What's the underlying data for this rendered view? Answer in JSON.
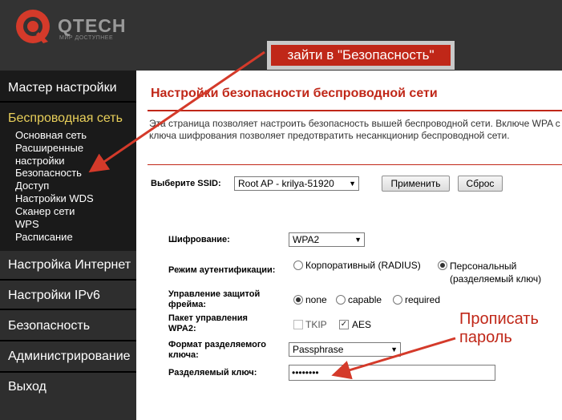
{
  "brand": {
    "name": "QTECH",
    "tagline": "МИР ДОСТУПНЕЕ",
    "accent_color": "#c02718",
    "logo_icon": "qtech-logo-icon"
  },
  "sidebar": {
    "items": [
      {
        "label": "Мастер настройки"
      },
      {
        "label": "Беспроводная сеть",
        "active": true,
        "children": [
          {
            "label": "Основная сеть"
          },
          {
            "label": "Расширенные настройки"
          },
          {
            "label": "Безопасность"
          },
          {
            "label": "Доступ"
          },
          {
            "label": "Настройки WDS"
          },
          {
            "label": "Сканер сети"
          },
          {
            "label": "WPS"
          },
          {
            "label": "Расписание"
          }
        ]
      },
      {
        "label": "Настройка Интернет"
      },
      {
        "label": "Настройки IPv6"
      },
      {
        "label": "Безопасность"
      },
      {
        "label": "Администрирование"
      },
      {
        "label": "Выход"
      }
    ]
  },
  "main": {
    "title": "Настройки безопасности беспроводной сети",
    "description": "Эта страница позволяет настроить безопасность вышей беспроводной сети. Включе WPA с использованием ключа шифрования позволяет предотвратить несанкционир беспроводной сети.",
    "ssid": {
      "label": "Выберите SSID:",
      "value": "Root AP - krilya-51920",
      "apply_label": "Применить",
      "reset_label": "Сброс"
    },
    "encryption": {
      "label": "Шифрование:",
      "value": "WPA2"
    },
    "auth_mode": {
      "label": "Режим аутентификации:",
      "options": [
        "Корпоративный (RADIUS)",
        "Персональный (разделяемый ключ)"
      ],
      "selected": "Персональный (разделяемый ключ)"
    },
    "frame_protection": {
      "label": "Управление защитой фрейма:",
      "options": [
        "none",
        "capable",
        "required"
      ],
      "selected": "none"
    },
    "wpa2_cipher": {
      "label": "Пакет управления WPA2:",
      "tkip_label": "TKIP",
      "aes_label": "AES",
      "aes_checked": true,
      "tkip_checked": false
    },
    "psk_format": {
      "label": "Формат разделяемого ключа:",
      "value": "Passphrase"
    },
    "psk": {
      "label": "Разделяемый ключ:",
      "masked_value": "••••••••"
    }
  },
  "annotations": {
    "callout": "зайти в \"Безопасность\"",
    "note_line1": "Прописать",
    "note_line2": "пароль",
    "color": "#c02718"
  }
}
